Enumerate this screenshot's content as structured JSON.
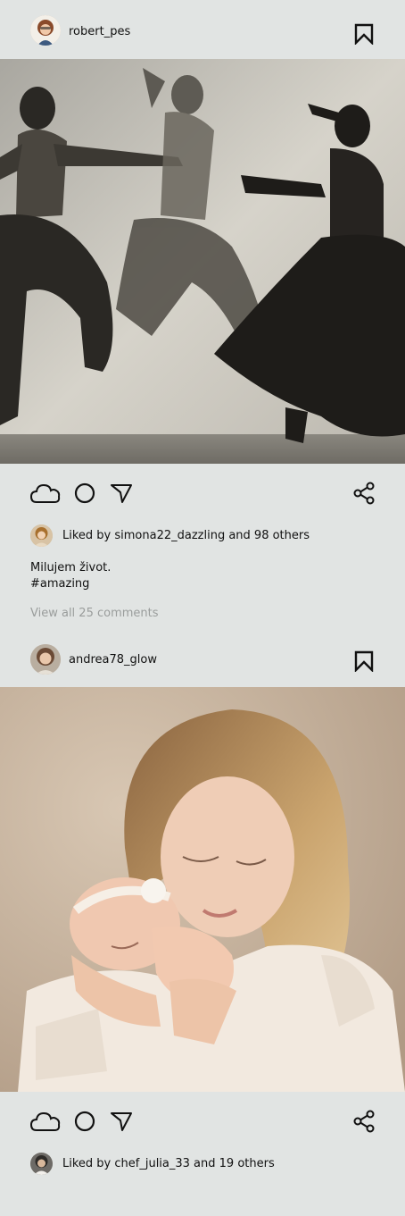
{
  "feed": {
    "posts": [
      {
        "username": "robert_pes",
        "likes_text": "Liked by simona22_dazzling and 98 others",
        "caption_line1": "Milujem život.",
        "caption_line2": "#amazing",
        "view_comments": "View all 25 comments"
      },
      {
        "username": "andrea78_glow",
        "likes_text": "Liked by chef_julia_33 and 19 others"
      }
    ]
  },
  "icons": {
    "avatar": "avatar-icon",
    "bookmark": "bookmark-icon",
    "like": "cloud-like-icon",
    "comment": "circle-comment-icon",
    "send": "triangle-send-icon",
    "share": "share-icon"
  },
  "colors": {
    "background": "#e1e4e3",
    "muted_text": "#9a9d9c"
  }
}
